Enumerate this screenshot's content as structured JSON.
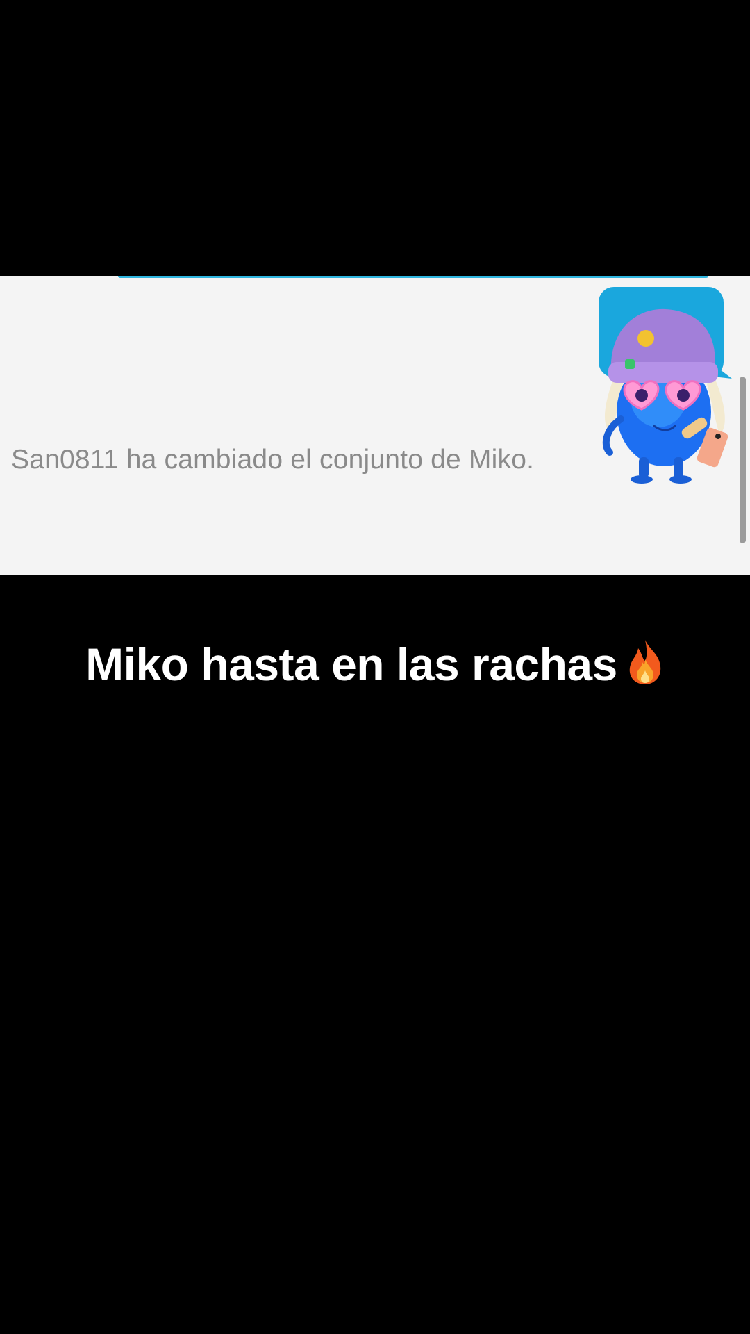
{
  "chat_panel": {
    "system_message": "San0811 ha cambiado el conjunto de Miko.",
    "mascot_icon": "miko-mascot-icon",
    "accent_color": "#2fb6e0",
    "background_color": "#f4f4f4"
  },
  "caption": {
    "text": "Miko hasta en las rachas",
    "emoji_icon": "fire-icon"
  }
}
